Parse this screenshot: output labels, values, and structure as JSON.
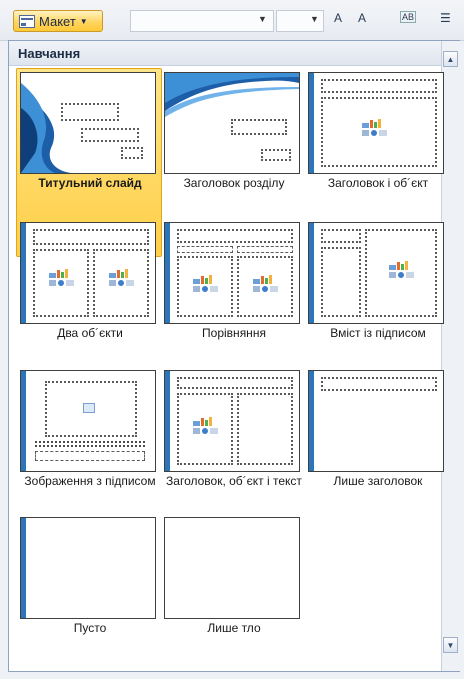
{
  "toolbar": {
    "layout_button_label": "Макет",
    "font_size_up": "A",
    "font_size_down": "A",
    "abc_label": "AB"
  },
  "gallery": {
    "section_title": "Навчання",
    "layouts": [
      {
        "label": "Титульний слайд",
        "selected": true
      },
      {
        "label": "Заголовок розділу"
      },
      {
        "label": "Заголовок і об´єкт"
      },
      {
        "label": "Два об´єкти"
      },
      {
        "label": "Порівняння"
      },
      {
        "label": "Вміст із підписом"
      },
      {
        "label": "Зображення з підписом"
      },
      {
        "label": "Заголовок, об´єкт і текст"
      },
      {
        "label": "Лише заголовок"
      },
      {
        "label": "Пусто"
      },
      {
        "label": "Лише тло"
      }
    ]
  },
  "colors": {
    "accent_blue": "#2a76b8",
    "selection_yellow": "#ffcf47"
  }
}
